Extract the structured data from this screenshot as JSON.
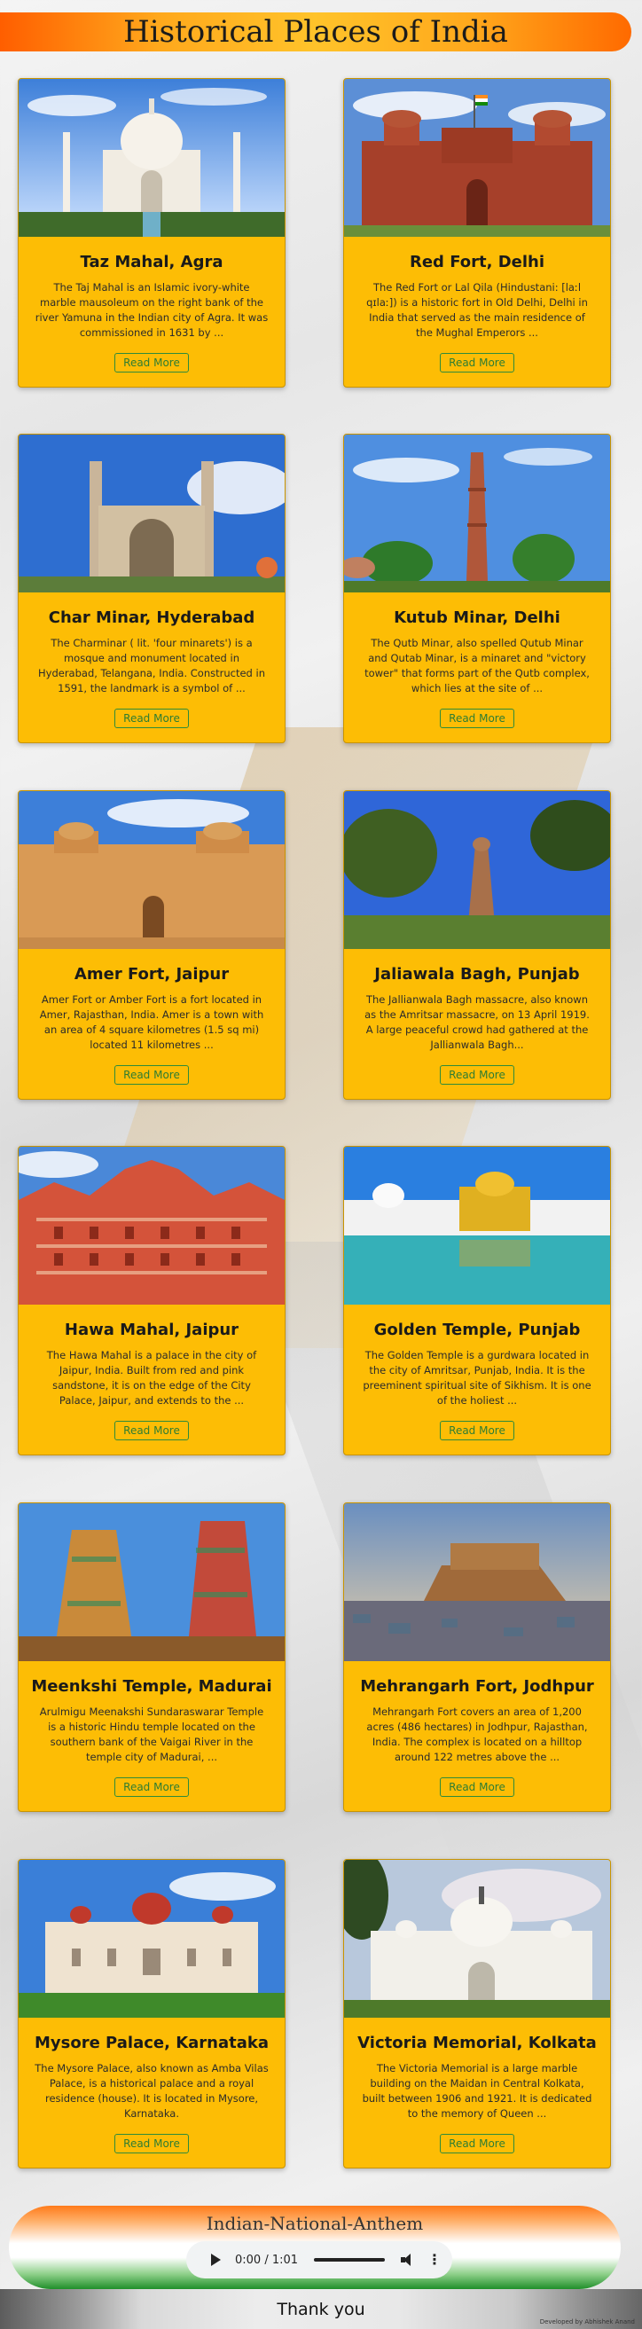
{
  "header": {
    "title": "Historical Places of India"
  },
  "cards": [
    {
      "title": "Taz Mahal, Agra",
      "desc": "The Taj Mahal is an Islamic ivory-white marble mausoleum on the right bank of the river Yamuna in the Indian city of Agra. It was commissioned in 1631 by ...",
      "button": "Read More"
    },
    {
      "title": "Red Fort, Delhi",
      "desc": "The Red Fort or Lal Qila (Hindustani: [laːl qɪlaː]) is a historic fort in Old Delhi, Delhi in India that served as the main residence of the Mughal Emperors ...",
      "button": "Read More"
    },
    {
      "title": "Char Minar, Hyderabad",
      "desc": "The Charminar ( lit. 'four minarets') is a mosque and monument located in Hyderabad, Telangana, India. Constructed in 1591, the landmark is a symbol of ...",
      "button": "Read More"
    },
    {
      "title": "Kutub Minar, Delhi",
      "desc": "The Qutb Minar, also spelled Qutub Minar and Qutab Minar, is a minaret and \"victory tower\" that forms part of the Qutb complex, which lies at the site of ...",
      "button": "Read More"
    },
    {
      "title": "Amer Fort, Jaipur",
      "desc": "Amer Fort or Amber Fort is a fort located in Amer, Rajasthan, India. Amer is a town with an area of 4 square kilometres (1.5 sq mi) located 11 kilometres ...",
      "button": "Read More"
    },
    {
      "title": "Jaliawala Bagh, Punjab",
      "desc": "The Jallianwala Bagh massacre, also known as the Amritsar massacre, on 13 April 1919. A large peaceful crowd had gathered at the Jallianwala Bagh...",
      "button": "Read More"
    },
    {
      "title": "Hawa Mahal, Jaipur",
      "desc": "The Hawa Mahal is a palace in the city of Jaipur, India. Built from red and pink sandstone, it is on the edge of the City Palace, Jaipur, and extends to the ...",
      "button": "Read More"
    },
    {
      "title": "Golden Temple, Punjab",
      "desc": "The Golden Temple is a gurdwara located in the city of Amritsar, Punjab, India. It is the preeminent spiritual site of Sikhism. It is one of the holiest ...",
      "button": "Read More"
    },
    {
      "title": "Meenkshi Temple, Madurai",
      "desc": "Arulmigu Meenakshi Sundaraswarar Temple is a historic Hindu temple located on the southern bank of the Vaigai River in the temple city of Madurai, ...",
      "button": "Read More"
    },
    {
      "title": "Mehrangarh Fort, Jodhpur",
      "desc": "Mehrangarh Fort covers an area of 1,200 acres (486 hectares) in Jodhpur, Rajasthan, India. The complex is located on a hilltop around 122 metres above the ...",
      "button": "Read More"
    },
    {
      "title": "Mysore Palace, Karnataka",
      "desc": "The Mysore Palace, also known as Amba Vilas Palace, is a historical palace and a royal residence (house). It is located in Mysore, Karnataka.",
      "button": "Read More"
    },
    {
      "title": "Victoria Memorial, Kolkata",
      "desc": "The Victoria Memorial is a large marble building on the Maidan in Central Kolkata, built between 1906 and 1921. It is dedicated to the memory of Queen ...",
      "button": "Read More"
    }
  ],
  "anthem": {
    "title": "Indian-National-Anthem",
    "time": "0:00 / 1:01"
  },
  "footer": {
    "thanks": "Thank you",
    "developer": "Developed by Abhishek Anand"
  }
}
